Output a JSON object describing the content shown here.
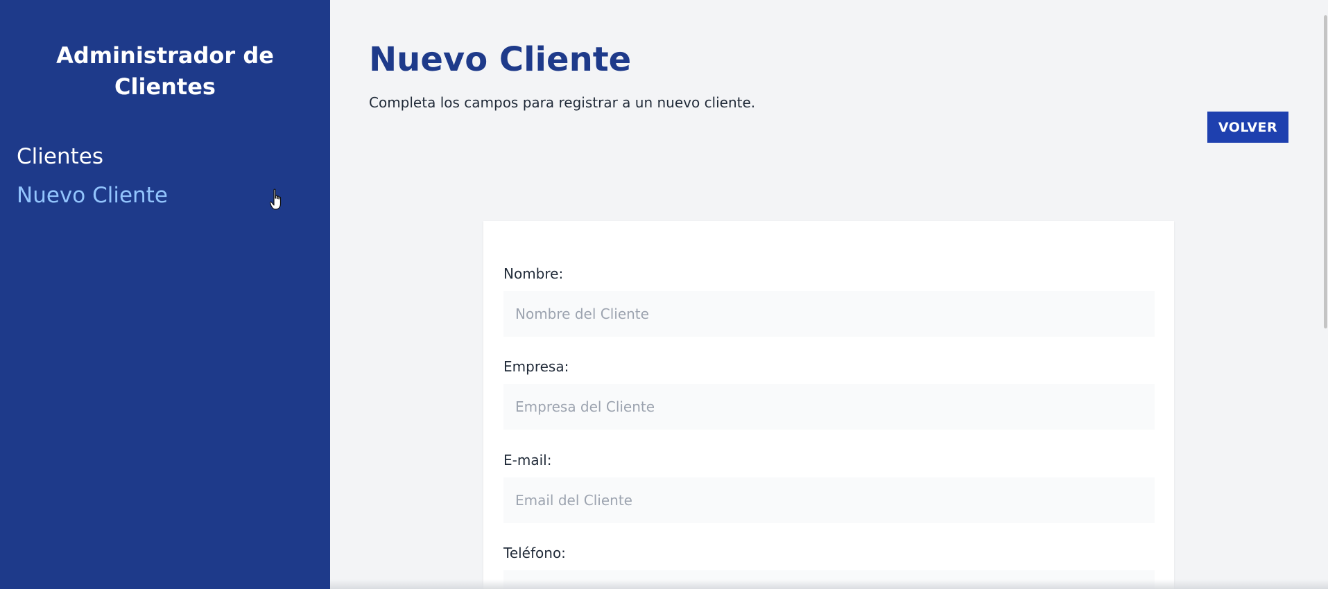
{
  "sidebar": {
    "title": "Administrador de Clientes",
    "items": [
      {
        "label": "Clientes",
        "active": false
      },
      {
        "label": "Nuevo Cliente",
        "active": true
      }
    ]
  },
  "header": {
    "title": "Nuevo Cliente",
    "subtitle": "Completa los campos para registrar a un nuevo cliente.",
    "back_button": "VOLVER"
  },
  "form": {
    "fields": [
      {
        "label": "Nombre:",
        "placeholder": "Nombre del Cliente",
        "value": ""
      },
      {
        "label": "Empresa:",
        "placeholder": "Empresa del Cliente",
        "value": ""
      },
      {
        "label": "E-mail:",
        "placeholder": "Email del Cliente",
        "value": ""
      },
      {
        "label": "Teléfono:",
        "placeholder": "",
        "value": ""
      }
    ]
  },
  "colors": {
    "sidebar_bg": "#1e3a8a",
    "accent": "#1e40af",
    "nav_active": "#93c5fd",
    "page_bg": "#f3f4f6"
  },
  "icons": {
    "cursor": "hand-pointer-icon"
  }
}
